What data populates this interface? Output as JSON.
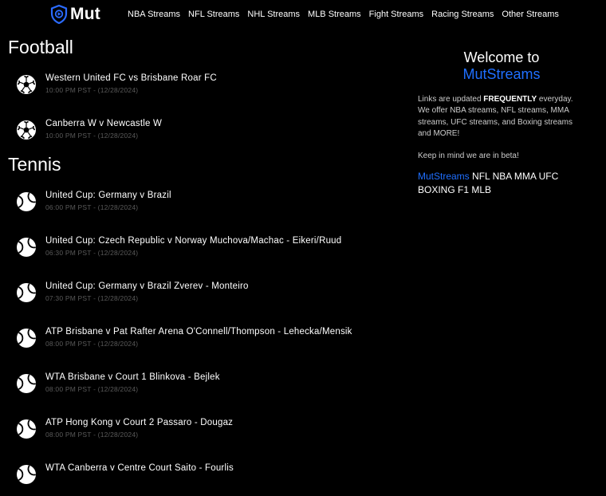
{
  "header": {
    "logo_text": "Mut",
    "nav": [
      "NBA Streams",
      "NFL Streams",
      "NHL Streams",
      "MLB Streams",
      "Fight Streams",
      "Racing Streams",
      "Other Streams"
    ]
  },
  "sections": [
    {
      "title": "Football",
      "events": [
        {
          "name": "Western United FC vs Brisbane Roar FC",
          "time": "10:00 PM PST - (12/28/2024)"
        },
        {
          "name": "Canberra W v Newcastle W",
          "time": "10:00 PM PST - (12/28/2024)"
        }
      ]
    },
    {
      "title": "Tennis",
      "events": [
        {
          "name": "United Cup: Germany v Brazil",
          "time": "06:00 PM PST - (12/28/2024)"
        },
        {
          "name": "United Cup: Czech Republic v Norway Muchova/Machac - Eikeri/Ruud",
          "time": "06:30 PM PST - (12/28/2024)"
        },
        {
          "name": "United Cup: Germany v Brazil Zverev - Monteiro",
          "time": "07:30 PM PST - (12/28/2024)"
        },
        {
          "name": "ATP Brisbane v Pat Rafter Arena O'Connell/Thompson - Lehecka/Mensik",
          "time": "08:00 PM PST - (12/28/2024)"
        },
        {
          "name": "WTA Brisbane v Court 1 Blinkova - Bejlek",
          "time": "08:00 PM PST - (12/28/2024)"
        },
        {
          "name": "ATP Hong Kong v Court 2 Passaro - Dougaz",
          "time": "08:00 PM PST - (12/28/2024)"
        },
        {
          "name": "WTA Canberra v Centre Court Saito - Fourlis",
          "time": ""
        }
      ]
    }
  ],
  "sidebar": {
    "welcome_line1": "Welcome to",
    "welcome_line2": "MutStreams",
    "p1_before": "Links are updated ",
    "p1_bold": "FREQUENTLY",
    "p1_after": " everyday. We offer NBA streams, NFL streams, MMA streams, UFC streams, and Boxing streams and MORE!",
    "p2": "Keep in mind we are in beta!",
    "sports_brand": "MutStreams",
    "sports_list": " NFL NBA MMA UFC BOXING F1 MLB"
  },
  "colors": {
    "accent": "#1f6fff",
    "background": "#000000",
    "muted": "#5a5a5a"
  }
}
